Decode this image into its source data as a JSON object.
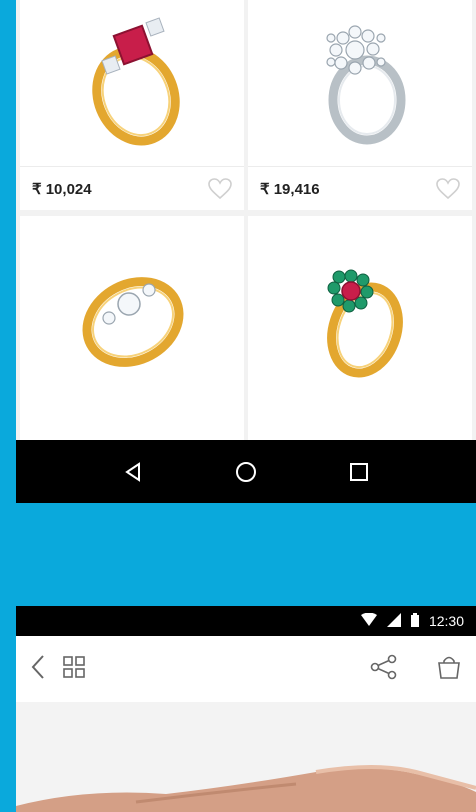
{
  "products": [
    {
      "price": "₹ 10,024",
      "image": "ruby-diamond-ring-icon"
    },
    {
      "price": "₹ 19,416",
      "image": "diamond-cluster-ring-icon"
    },
    {
      "price": "",
      "image": "diamond-twist-ring-icon"
    },
    {
      "price": "",
      "image": "emerald-ruby-flower-ring-icon"
    }
  ],
  "nav": {
    "back": "back-icon",
    "home": "home-icon",
    "recents": "recents-icon"
  },
  "status": {
    "time": "12:30"
  },
  "appbar": {
    "back": "chevron-left-icon",
    "grid": "grid-view-icon",
    "share": "share-icon",
    "bag": "shopping-bag-icon"
  },
  "colors": {
    "background": "#0aa9dc",
    "gold": "#e3a72f",
    "ruby": "#c81e4a",
    "emerald": "#1f9a6a"
  }
}
